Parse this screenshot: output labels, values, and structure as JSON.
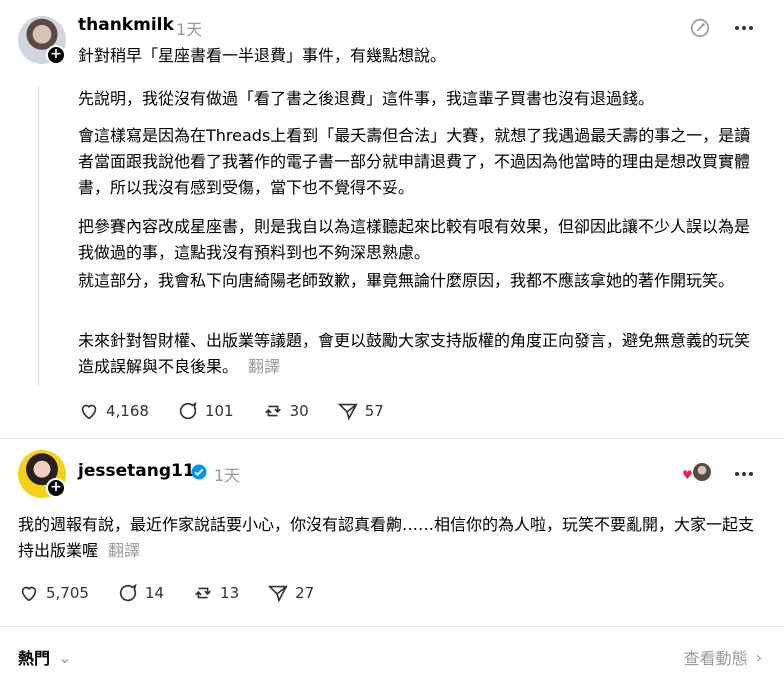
{
  "post1": {
    "username": "thankmilk",
    "time": "1天",
    "intro": "針對稍早「星座書看一半退費」事件，有幾點想說。",
    "paragraphs": [
      "先說明，我從沒有做過「看了書之後退費」這件事，我這輩子買書也沒有退過錢。",
      "會這樣寫是因為在Threads上看到「最夭壽但合法」大賽，就想了我遇過最夭壽的事之一，是讀者當面跟我說他看了我著作的電子書一部分就申請退費了，不過因為他當時的理由是想改買實體書，所以我沒有感到受傷，當下也不覺得不妥。",
      "把參賽內容改成星座書，則是我自以為這樣聽起來比較有哏有效果，但卻因此讓不少人誤以為是我做過的事，這點我沒有預料到也不夠深思熟慮。",
      "就這部分，我會私下向唐綺陽老師致歉，畢竟無論什麼原因，我都不應該拿她的著作開玩笑。",
      "未來針對智財權、出版業等議題，會更以鼓勵大家支持版權的角度正向發言，避免無意義的玩笑造成誤解與不良後果。"
    ],
    "translate": "翻譯",
    "likes": "4,168",
    "replies": "101",
    "reposts": "30",
    "shares": "57"
  },
  "post2": {
    "username": "jessetang11",
    "time": "1天",
    "text": "我的週報有說，最近作家說話要小心，你沒有認真看齁……相信你的為人啦，玩笑不要亂開，大家一起支持出版業喔",
    "translate": "翻譯",
    "likes": "5,705",
    "replies": "14",
    "reposts": "13",
    "shares": "27"
  },
  "footer": {
    "sort_label": "熱門",
    "view_activity": "查看動態"
  },
  "icons": {
    "verified_color": "#0095f6"
  }
}
